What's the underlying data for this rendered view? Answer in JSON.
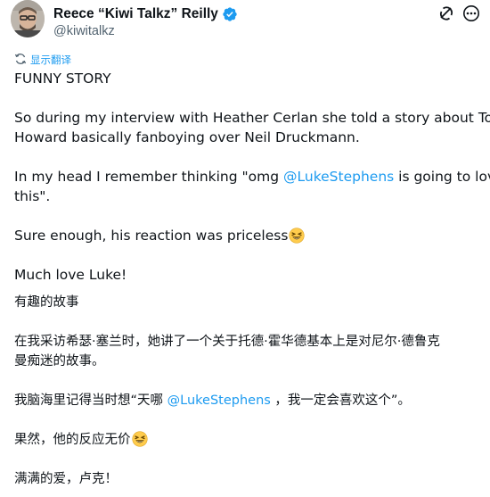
{
  "author": {
    "display_name": "Reece “Kiwi Talkz” Reilly",
    "handle": "@kiwitalkz",
    "verified_icon": "verified-badge-icon"
  },
  "actions": {
    "grok_icon": "grok-icon",
    "more_icon": "more-options-icon"
  },
  "translate": {
    "icon": "translate-icon",
    "label": "显示翻译"
  },
  "tweet": {
    "title": "FUNNY STORY",
    "p1_line1": "So during my interview with Heather Cerlan she told a story about Todd",
    "p1_line2": "Howard basically fanboying over Neil Druckmann.",
    "p2_pre": "In my head I remember thinking \"omg ",
    "p2_mention": "@LukeStephens",
    "p2_post": " is going to love",
    "p2_line2": "this\".",
    "p3": "Sure enough, his reaction was priceless",
    "p4": "Much love Luke!",
    "emoji_icon": "laughing-emoji-icon"
  },
  "translation": {
    "title": "有趣的故事",
    "p1_line1": "在我采访希瑟·塞兰时，她讲了一个关于托德·霍华德基本上是对尼尔·德鲁克",
    "p1_line2": "曼痴迷的故事。",
    "p2_pre": "我脑海里记得当时想“天哪 ",
    "p2_mention": "@LukeStephens",
    "p2_post": " ，我一定会喜欢这个”。",
    "p3": "果然，他的反应无价",
    "p4": "满满的爱，卢克！"
  },
  "colors": {
    "accent": "#1d9bf0",
    "text": "#0f1419",
    "secondary": "#536471"
  }
}
